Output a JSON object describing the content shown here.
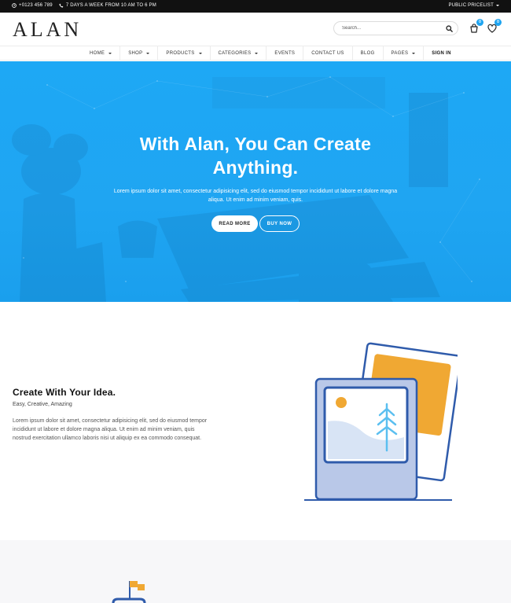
{
  "topbar": {
    "phone": "+0123 456 789",
    "hours": "7 DAYS A WEEK FROM 10 AM TO 6 PM",
    "pricelist": "PUBLIC PRICELIST"
  },
  "header": {
    "logo": "ALAN",
    "search_placeholder": "Search...",
    "cart_count": "0",
    "wishlist_count": "0"
  },
  "nav": {
    "items": [
      {
        "label": "HOME",
        "dropdown": true
      },
      {
        "label": "SHOP",
        "dropdown": true
      },
      {
        "label": "PRODUCTS",
        "dropdown": true
      },
      {
        "label": "CATEGORIES",
        "dropdown": true
      },
      {
        "label": "EVENTS",
        "dropdown": false
      },
      {
        "label": "CONTACT US",
        "dropdown": false
      },
      {
        "label": "BLOG",
        "dropdown": false
      },
      {
        "label": "PAGES",
        "dropdown": true
      },
      {
        "label": "SIGN IN",
        "dropdown": false
      }
    ]
  },
  "hero": {
    "title_line1": "With Alan, You Can Create",
    "title_line2": "Anything.",
    "text": "Lorem ipsum dolor sit amet, consectetur adipisicing elit, sed do eiusmod tempor incididunt ut labore et dolore magna aliqua. Ut enim ad minim veniam, quis.",
    "read_more": "READ MORE",
    "buy_now": "BUY NOW",
    "accent_color": "#1ea6f3"
  },
  "feature": {
    "title": "Create With Your Idea.",
    "subtitle": "Easy, Creative, Amazing",
    "body": "Lorem ipsum dolor sit amet, consectetur adipisicing elit, sed do eiusmod tempor incididunt ut labore et dolore magna aliqua. Ut enim ad minim veniam, quis nostrud exercitation ullamco laboris nisi ut aliquip ex ea commodo consequat."
  },
  "icons": {
    "phone": "phone-icon",
    "clock": "clock-icon",
    "search": "search-icon",
    "cart": "cart-icon",
    "wishlist": "heart-icon",
    "illustration": "picture-frames-illustration",
    "flag": "flag-icon"
  }
}
